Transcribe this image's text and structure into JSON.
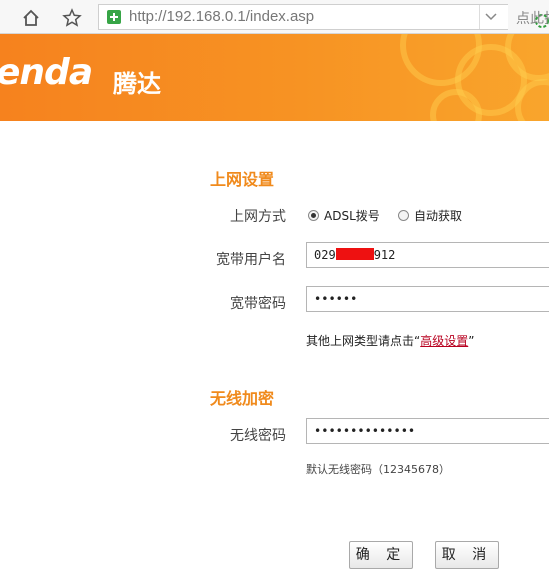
{
  "browser": {
    "url_host": "http://192.168.0.1",
    "url_path": "/index.asp",
    "right_text": "点此拉"
  },
  "brand": {
    "logo_text": "enda",
    "logo_cn": "腾达",
    "banner_color": "#f7881f"
  },
  "section_internet": {
    "title": "上网设置",
    "mode_label": "上网方式",
    "mode_options": [
      "ADSL拨号",
      "自动获取"
    ],
    "mode_selected": "ADSL拨号",
    "user_label": "宽带用户名",
    "user_prefix": "029",
    "user_suffix": "912",
    "pass_label": "宽带密码",
    "pass_value": "••••••",
    "note_prefix": "其他上网类型请点击“",
    "note_link": "高级设置",
    "note_suffix": "”"
  },
  "section_wireless": {
    "title": "无线加密",
    "pass_label": "无线密码",
    "pass_value": "••••••••••••••",
    "hint": "默认无线密码（12345678）"
  },
  "buttons": {
    "confirm": "确 定",
    "cancel": "取 消"
  },
  "colors": {
    "accent": "#f08a1c",
    "link": "#b8001f",
    "mask": "#ee1111"
  }
}
